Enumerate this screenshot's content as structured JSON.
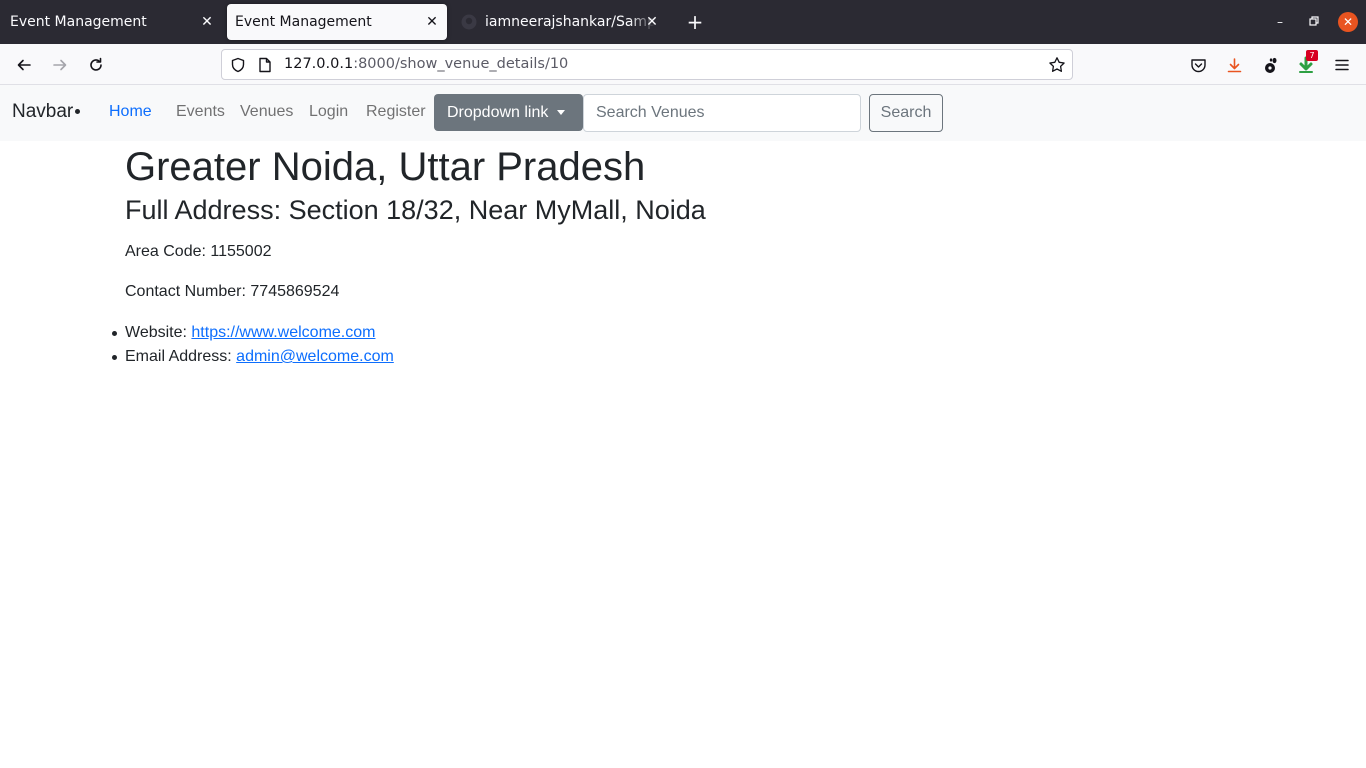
{
  "browser": {
    "tabs": [
      {
        "title": "Event Management",
        "active": false
      },
      {
        "title": "Event Management",
        "active": true
      },
      {
        "title": "iamneerajshankar/Sample",
        "active": false
      }
    ],
    "url": {
      "host": "127.0.0.1",
      "rest": ":8000/show_venue_details/10"
    },
    "extension_badge": "7"
  },
  "navbar": {
    "brand": "Navbar",
    "links": {
      "home": "Home",
      "events": "Events",
      "venues": "Venues",
      "login": "Login",
      "register": "Register"
    },
    "dropdown_label": "Dropdown link",
    "search_placeholder": "Search Venues",
    "search_button": "Search"
  },
  "venue": {
    "title": "Greater Noida, Uttar Pradesh",
    "address_label": "Full Address:",
    "address": "Section 18/32, Near MyMall, Noida",
    "area_code_label": "Area Code:",
    "area_code": "1155002",
    "contact_label": "Contact Number:",
    "contact": "7745869524",
    "website_label": "Website:",
    "website": "https://www.welcome.com",
    "email_label": "Email Address:",
    "email": "admin@welcome.com"
  },
  "colors": {
    "accent": "#0d6efd",
    "navbar_bg": "#f8f9fa",
    "dropdown_bg": "#6c757d",
    "tabstrip_bg": "#2b2a33",
    "window_close": "#e95420"
  }
}
